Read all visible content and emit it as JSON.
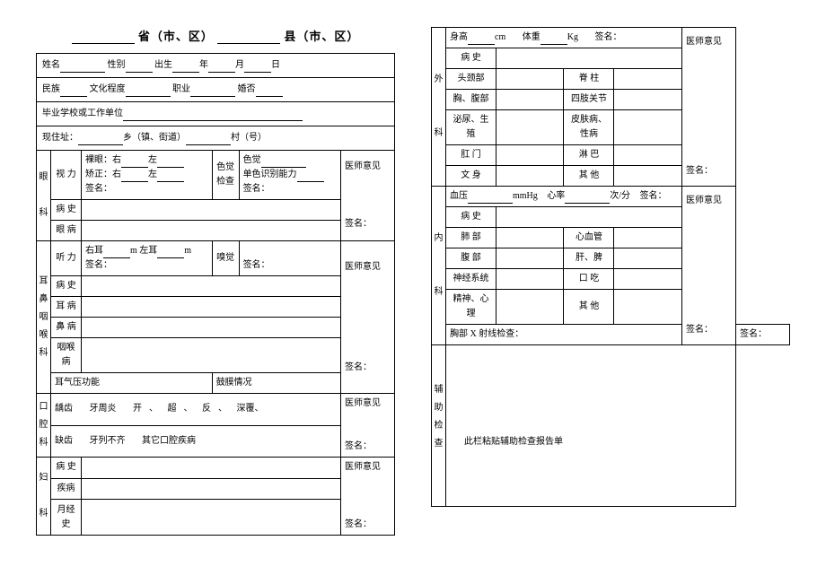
{
  "title": {
    "prov": "省（市、区）",
    "county": "县（市、区）"
  },
  "info": {
    "name": "姓名",
    "sex": "性别",
    "birth": "出生",
    "year": "年",
    "month": "月",
    "day": "日",
    "ethnic": "民族",
    "edu": "文化程度",
    "occ": "职业",
    "marry": "婚否",
    "grad": "毕业学校或工作单位",
    "addr": "现住址：",
    "town": "乡（镇、街道）",
    "village": "村（号）"
  },
  "col_op": "医师意见",
  "sign": "签名：",
  "eye": {
    "title": "眼\n\n科",
    "vision": "视 力",
    "naked": "裸眼：右",
    "left": "左",
    "corr": "矫正：右",
    "sign_under": "签名：",
    "color_check": "色觉\n检查",
    "color_sense": "色觉",
    "mono": "单色识别能力",
    "history": "病  史",
    "disease": "眼  病"
  },
  "ent": {
    "title": "耳\n鼻\n咽\n喉\n科",
    "hearing": "听 力",
    "r_ear": "右耳",
    "l_ear": "m 左耳",
    "m": "m",
    "whisper": "嗅觉",
    "history": "病  史",
    "ear": "耳  病",
    "nose": "鼻  病",
    "throat": "咽喉病",
    "eardrum": "耳气压功能",
    "drum_status": "鼓膜情况"
  },
  "oral": {
    "title": "口\n腔\n科",
    "decay": "龋齿",
    "gum": "牙周炎",
    "open": "开",
    "bite_over": "超",
    "bite_anti": "反",
    "deep": "深覆",
    "missing": "缺齿",
    "irr": "牙列不齐",
    "other": "其它口腔疾病"
  },
  "gyn": {
    "title": "妇\n\n科",
    "history": "病  史",
    "disease": "疾病",
    "menses": "月经史"
  },
  "surg": {
    "title": "外\n\n\n科",
    "height": "身高",
    "cm": "cm",
    "weight": "体重",
    "kg": "Kg",
    "history": "病  史",
    "head": "头颈部",
    "spine": "脊  柱",
    "chest": "胸、腹部",
    "limbs": "四肢关节",
    "urine": "泌尿、生殖",
    "skin": "皮肤病、性病",
    "anus": "肛  门",
    "lymph": "淋  巴",
    "tattoo": "文  身",
    "other": "其  他"
  },
  "int": {
    "title": "内\n\n\n科",
    "bp": "血压",
    "mmhg": "mmHg",
    "hr": "心率",
    "bpm": "次/分",
    "history": "病  史",
    "lung": "肺  部",
    "heart": "心血管",
    "abdomen": "腹  部",
    "liver": "肝、脾",
    "nerve": "神经系统",
    "stutter": "口  吃",
    "mental": "精神、心理",
    "other": "其  他"
  },
  "xray": "胸部 X 射线检查：",
  "aux": {
    "title": "辅\n助\n检\n查",
    "note": "此栏粘贴辅助检查报告单"
  }
}
